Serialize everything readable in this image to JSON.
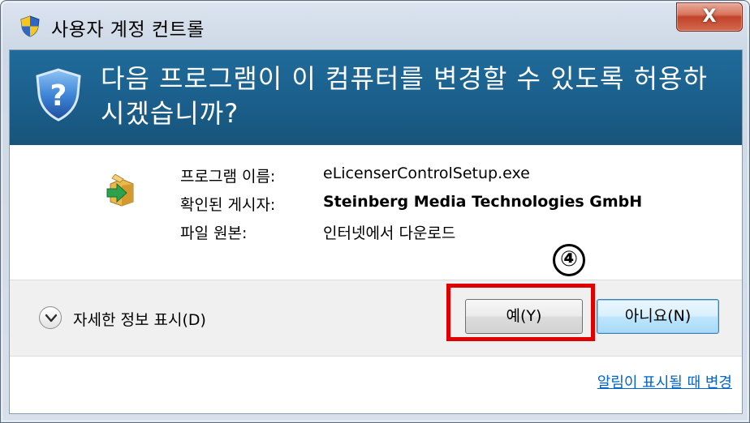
{
  "window": {
    "title": "사용자 계정 컨트롤",
    "close_label": "X"
  },
  "header": {
    "question": "다음 프로그램이 이 컴퓨터를 변경할 수 있도록 허용하시겠습니까?"
  },
  "details": {
    "program_name_label": "프로그램 이름:",
    "program_name_value": "eLicenserControlSetup.exe",
    "publisher_label": "확인된 게시자:",
    "publisher_value": "Steinberg Media Technologies GmbH",
    "origin_label": "파일 원본:",
    "origin_value": "인터넷에서 다운로드"
  },
  "buttons": {
    "show_details": "자세한 정보 표시(D)",
    "yes": "예(Y)",
    "no": "아니요(N)"
  },
  "link": {
    "change_notifications": "알림이 표시될 때 변경"
  },
  "annotation": {
    "step_number": "④",
    "highlight_color": "#e00000"
  },
  "colors": {
    "header_blue": "#1b5f8c",
    "link_blue": "#0066cc"
  }
}
